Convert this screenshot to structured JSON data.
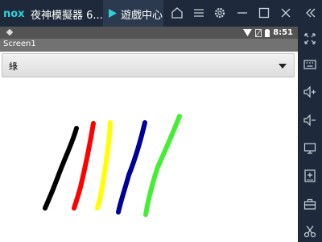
{
  "window": {
    "app_title": "夜神模擬器 6...",
    "game_center_tab": "遊戲中心",
    "brand_color": "#2fd0d8"
  },
  "android": {
    "status_time": "8:51",
    "screen_title": "Screen1",
    "color_spinner": {
      "selected": "綠"
    }
  },
  "strokes": [
    {
      "color": "#000000",
      "label": "black"
    },
    {
      "color": "#ff0000",
      "label": "red"
    },
    {
      "color": "#ffff00",
      "label": "yellow"
    },
    {
      "color": "#000099",
      "label": "navy"
    },
    {
      "color": "#44ee33",
      "label": "green"
    }
  ],
  "sidebar": {
    "icons": [
      "fullscreen-icon",
      "keyboard-icon",
      "volume-up-icon",
      "volume-down-icon",
      "screen-icon",
      "add-apk-icon",
      "toolbox-icon",
      "scissors-icon"
    ]
  }
}
